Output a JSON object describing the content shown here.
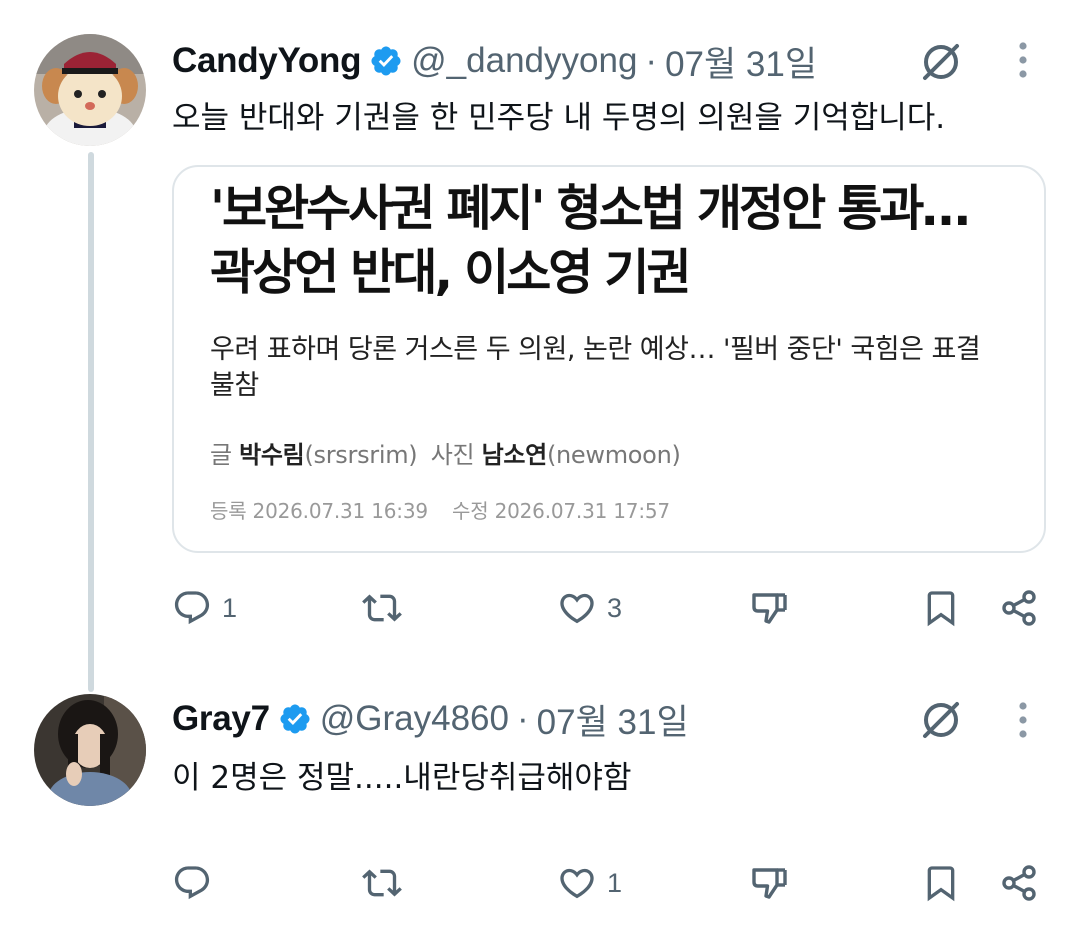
{
  "colors": {
    "verified_blue": "#1d9bf0",
    "icon_gray": "#536471",
    "thread_line": "#cfd9de"
  },
  "posts": [
    {
      "display_name": "CandyYong",
      "handle": "@_dandyyong",
      "separator": "·",
      "date": "07월 31일",
      "text": "오늘 반대와 기권을 한 민주당 내 두명의 의원을 기억합니다.",
      "avatar": "mascot-avatar",
      "embedded_article": {
        "title_line1": "'보완수사권 폐지' 형소법 개정안 통과…",
        "title_line2": "곽상언 반대, 이소영 기권",
        "subtitle": "우려 표하며 당론 거스른 두 의원, 논란 예상… '필버 중단' 국힘은 표결 불참",
        "byline": {
          "writer_label": "글",
          "writer_name": "박수림",
          "writer_id": "(srsrsrim)",
          "photo_label": "사진",
          "photographer_name": "남소연",
          "photographer_id": "(newmoon)"
        },
        "registered": "등록 2026.07.31 16:39",
        "modified": "수정 2026.07.31 17:57"
      },
      "actions": {
        "reply_count": "1",
        "repost_count": "",
        "like_count": "3"
      }
    },
    {
      "display_name": "Gray7",
      "handle": "@Gray4860",
      "separator": "·",
      "date": "07월 31일",
      "text": "이 2명은 정말.....내란당취급해야함",
      "avatar": "photo-avatar",
      "actions": {
        "reply_count": "",
        "repost_count": "",
        "like_count": "1"
      }
    }
  ]
}
